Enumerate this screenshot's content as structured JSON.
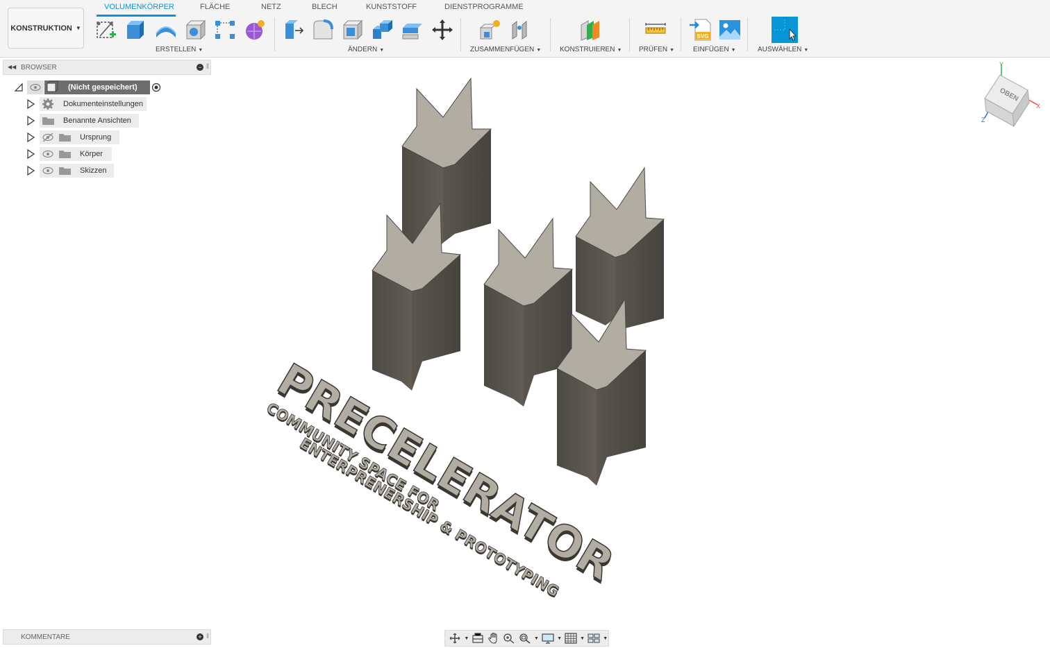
{
  "workspace": {
    "label": "KONSTRUKTION"
  },
  "tabs": [
    {
      "label": "VOLUMENKÖRPER",
      "active": true
    },
    {
      "label": "FLÄCHE"
    },
    {
      "label": "NETZ"
    },
    {
      "label": "BLECH"
    },
    {
      "label": "KUNSTSTOFF"
    },
    {
      "label": "DIENSTPROGRAMME"
    }
  ],
  "groups": {
    "erstellen": "ERSTELLEN",
    "aendern": "ÄNDERN",
    "zusammenfuegen": "ZUSAMMENFÜGEN",
    "konstruieren": "KONSTRUIEREN",
    "pruefen": "PRÜFEN",
    "einfuegen": "EINFÜGEN",
    "auswaehlen": "AUSWÄHLEN"
  },
  "browser": {
    "title": "BROWSER",
    "root": "(Nicht gespeichert)",
    "items": [
      {
        "label": "Dokumenteinstellungen",
        "icon": "gear-icon"
      },
      {
        "label": "Benannte Ansichten",
        "icon": "folder-icon"
      },
      {
        "label": "Ursprung",
        "icon": "folder-icon",
        "visibility": "hidden"
      },
      {
        "label": "Körper",
        "icon": "folder-icon",
        "visibility": "visible"
      },
      {
        "label": "Skizzen",
        "icon": "folder-icon",
        "visibility": "visible"
      }
    ]
  },
  "comments": {
    "title": "KOMMENTARE"
  },
  "viewcube": {
    "face": "OBEN",
    "axes": [
      "X",
      "Y",
      "Z"
    ]
  },
  "model": {
    "title": "PRECELERATOR",
    "line1": "COMMUNITY SPACE FOR",
    "line2": "ENTERPRENERSHIP & PROTOTYPING"
  },
  "colors": {
    "accent": "#0696d7",
    "model_face": "#57534c",
    "model_top": "#b2ada3",
    "select_active": "#0696d7"
  }
}
